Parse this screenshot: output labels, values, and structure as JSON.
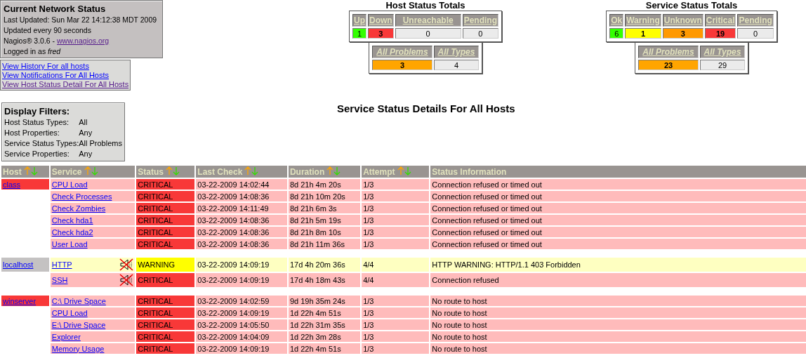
{
  "info": {
    "title": "Current Network Status",
    "last_updated": "Last Updated: Sun Mar 22 14:12:38 MDT 2009",
    "interval": "Updated every 90 seconds",
    "version": "Nagios® 3.0.6 - ",
    "version_link": "www.nagios.org",
    "login": "Logged in as *fred*"
  },
  "links": [
    {
      "label": "View History For all hosts",
      "visited": false
    },
    {
      "label": "View Notifications For All Hosts",
      "visited": false
    },
    {
      "label": "View Host Status Detail For All Hosts",
      "visited": true
    }
  ],
  "host_totals": {
    "title": "Host Status Totals",
    "counts": [
      {
        "label": "Up",
        "value": "1",
        "color": "#33ff00",
        "kind": "ok"
      },
      {
        "label": "Down",
        "value": "3",
        "color": "#f83838",
        "kind": "problem"
      },
      {
        "label": "Unreachable",
        "value": "0",
        "color": "#ebebeb",
        "kind": "none"
      },
      {
        "label": "Pending",
        "value": "0",
        "color": "#ebebeb",
        "kind": "none"
      }
    ],
    "summary": [
      {
        "label": "All Problems",
        "value": "3",
        "color": "#ffa500",
        "kind": "problem"
      },
      {
        "label": "All Types",
        "value": "4",
        "color": "#ebebeb",
        "kind": "none"
      }
    ]
  },
  "service_totals": {
    "title": "Service Status Totals",
    "counts": [
      {
        "label": "Ok",
        "value": "6",
        "color": "#33ff00",
        "kind": "ok"
      },
      {
        "label": "Warning",
        "value": "1",
        "color": "#ffff00",
        "kind": "problem"
      },
      {
        "label": "Unknown",
        "value": "3",
        "color": "#ff9900",
        "kind": "problem"
      },
      {
        "label": "Critical",
        "value": "19",
        "color": "#f83838",
        "kind": "problem"
      },
      {
        "label": "Pending",
        "value": "0",
        "color": "#ebebeb",
        "kind": "none"
      }
    ],
    "summary": [
      {
        "label": "All Problems",
        "value": "23",
        "color": "#ffa500",
        "kind": "problem"
      },
      {
        "label": "All Types",
        "value": "29",
        "color": "#ebebeb",
        "kind": "none"
      }
    ]
  },
  "filters": {
    "title": "Display Filters:",
    "rows": [
      {
        "label": "Host Status Types:",
        "value": "All"
      },
      {
        "label": "Host Properties:",
        "value": "Any"
      },
      {
        "label": "Service Status Types:",
        "value": "All Problems"
      },
      {
        "label": "Service Properties:",
        "value": "Any"
      }
    ]
  },
  "page_title": "Service Status Details For All Hosts",
  "table": {
    "columns": [
      {
        "label": "Host",
        "sortable": true
      },
      {
        "label": "Service",
        "sortable": true
      },
      {
        "label": "Status",
        "sortable": true
      },
      {
        "label": "Last Check",
        "sortable": true
      },
      {
        "label": "Duration",
        "sortable": true
      },
      {
        "label": "Attempt",
        "sortable": true
      },
      {
        "label": "Status Information",
        "sortable": false
      }
    ],
    "groups": [
      {
        "host": "class",
        "color": "#f83838",
        "services": [
          {
            "name": "CPU Load",
            "notifications_disabled": false,
            "status": "CRITICAL",
            "kind": "critical",
            "last_check": "03-22-2009 14:02:44",
            "duration": "8d 21h 4m 20s",
            "attempt": "1/3",
            "info": "Connection refused or timed out"
          },
          {
            "name": "Check Processes",
            "notifications_disabled": false,
            "status": "CRITICAL",
            "kind": "critical",
            "last_check": "03-22-2009 14:08:36",
            "duration": "8d 21h 10m 20s",
            "attempt": "1/3",
            "info": "Connection refused or timed out"
          },
          {
            "name": "Check Zombies",
            "notifications_disabled": false,
            "status": "CRITICAL",
            "kind": "critical",
            "last_check": "03-22-2009 14:11:49",
            "duration": "8d 21h 6m 3s",
            "attempt": "1/3",
            "info": "Connection refused or timed out"
          },
          {
            "name": "Check hda1",
            "notifications_disabled": false,
            "status": "CRITICAL",
            "kind": "critical",
            "last_check": "03-22-2009 14:08:36",
            "duration": "8d 21h 5m 19s",
            "attempt": "1/3",
            "info": "Connection refused or timed out"
          },
          {
            "name": "Check hda2",
            "notifications_disabled": false,
            "status": "CRITICAL",
            "kind": "critical",
            "last_check": "03-22-2009 14:08:36",
            "duration": "8d 21h 8m 10s",
            "attempt": "1/3",
            "info": "Connection refused or timed out"
          },
          {
            "name": "User Load",
            "notifications_disabled": false,
            "status": "CRITICAL",
            "kind": "critical",
            "last_check": "03-22-2009 14:08:36",
            "duration": "8d 21h 11m 36s",
            "attempt": "1/3",
            "info": "Connection refused or timed out"
          }
        ]
      },
      {
        "host": "localhost",
        "color": "#c4c2c2",
        "services": [
          {
            "name": "HTTP",
            "notifications_disabled": true,
            "status": "WARNING",
            "kind": "warning",
            "last_check": "03-22-2009 14:09:19",
            "duration": "17d 4h 20m 36s",
            "attempt": "4/4",
            "info": "HTTP WARNING: HTTP/1.1 403 Forbidden"
          },
          {
            "name": "SSH",
            "notifications_disabled": true,
            "status": "CRITICAL",
            "kind": "critical",
            "last_check": "03-22-2009 14:09:19",
            "duration": "17d 4h 18m 43s",
            "attempt": "4/4",
            "info": "Connection refused"
          }
        ]
      },
      {
        "host": "winserver",
        "color": "#f83838",
        "services": [
          {
            "name": "C:\\ Drive Space",
            "notifications_disabled": false,
            "status": "CRITICAL",
            "kind": "critical",
            "last_check": "03-22-2009 14:02:59",
            "duration": "9d 19h 35m 24s",
            "attempt": "1/3",
            "info": "No route to host"
          },
          {
            "name": "CPU Load",
            "notifications_disabled": false,
            "status": "CRITICAL",
            "kind": "critical",
            "last_check": "03-22-2009 14:09:19",
            "duration": "1d 22h 4m 51s",
            "attempt": "1/3",
            "info": "No route to host"
          },
          {
            "name": "E:\\ Drive Space",
            "notifications_disabled": false,
            "status": "CRITICAL",
            "kind": "critical",
            "last_check": "03-22-2009 14:05:50",
            "duration": "1d 22h 31m 35s",
            "attempt": "1/3",
            "info": "No route to host"
          },
          {
            "name": "Explorer",
            "notifications_disabled": false,
            "status": "CRITICAL",
            "kind": "critical",
            "last_check": "03-22-2009 14:04:09",
            "duration": "1d 22h 3m 28s",
            "attempt": "1/3",
            "info": "No route to host"
          },
          {
            "name": "Memory Usage",
            "notifications_disabled": false,
            "status": "CRITICAL",
            "kind": "critical",
            "last_check": "03-22-2009 14:09:19",
            "duration": "1d 22h 4m 51s",
            "attempt": "1/3",
            "info": "No route to host"
          }
        ]
      }
    ]
  }
}
